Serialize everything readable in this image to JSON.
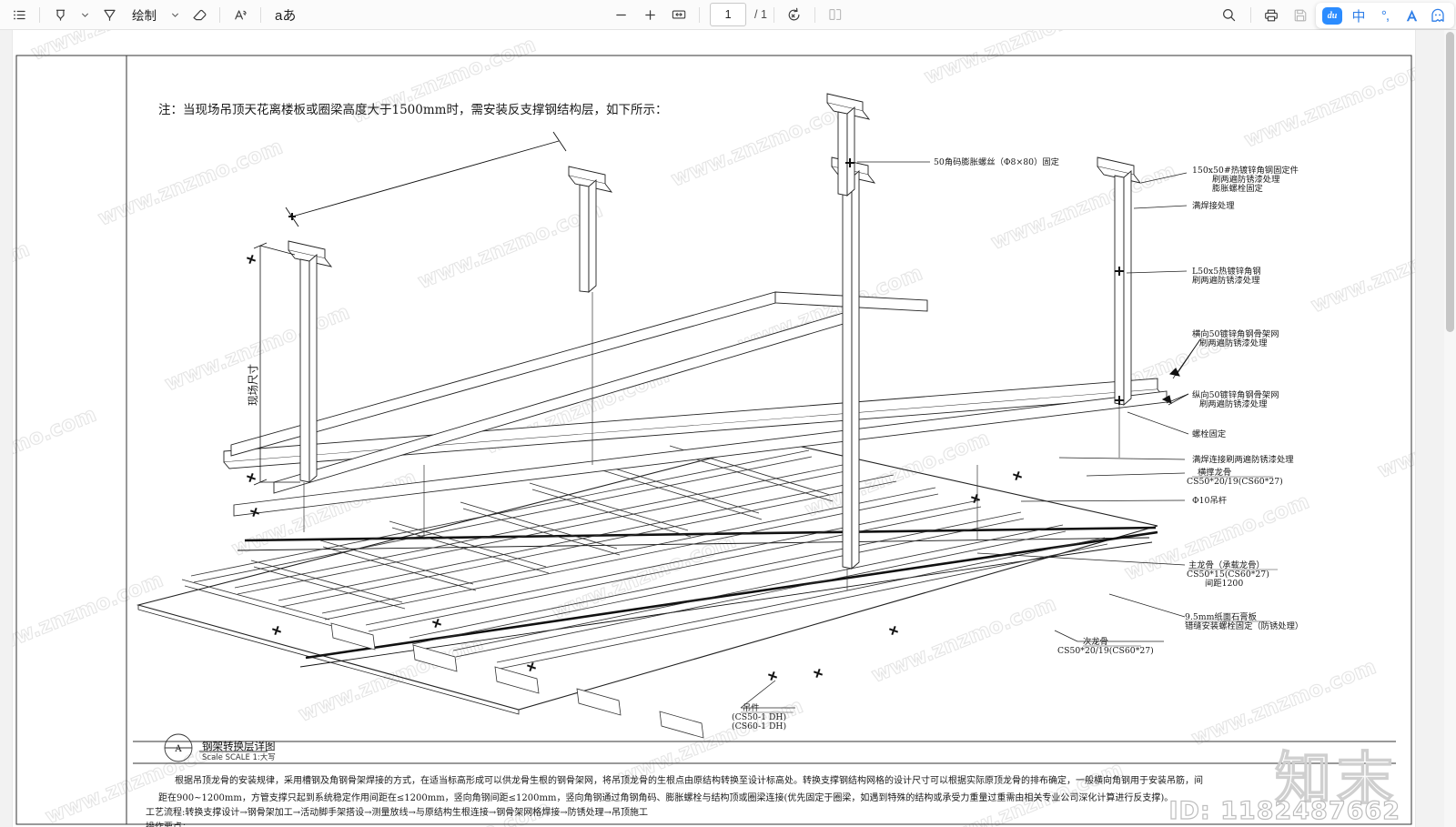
{
  "toolbar": {
    "left_tools": [
      {
        "name": "outline-list-icon",
        "label": ""
      },
      {
        "name": "highlighter-icon",
        "label": ""
      },
      {
        "name": "highlighter-dropdown-icon",
        "label": ""
      },
      {
        "name": "pen-icon",
        "label": ""
      },
      {
        "name": "draw-label",
        "label": "绘制"
      },
      {
        "name": "draw-dropdown-icon",
        "label": ""
      },
      {
        "name": "eraser-icon",
        "label": ""
      },
      {
        "name": "text-style-icon",
        "label": ""
      },
      {
        "name": "font-size-icon",
        "label": "aあ"
      }
    ],
    "draw_label": "绘制",
    "font_label": "aあ",
    "zoom_out": "−",
    "zoom_in": "+",
    "fit_width": "fit-width-icon",
    "page_current": "1",
    "page_total": "/ 1",
    "rotate": "rotate-icon",
    "dual_page": "dual-page-icon",
    "search": "search-icon",
    "print": "print-icon",
    "save": "save-icon"
  },
  "ime": {
    "logo": "du",
    "mode": "中",
    "punctuation": "°,",
    "input_icon": "A",
    "toolbox_icon": "ghost-icon"
  },
  "document": {
    "note": "注：当现场吊顶天花离楼板或圈梁高度大于1500mm时，需安装反支撑钢结构层，如下所示：",
    "vertical_dimension": "现场尺寸",
    "title_block": {
      "marker": "A",
      "title": "钢架转换层详图",
      "scale_prefix": "Scale",
      "scale_bold": "SCALE",
      "scale_value": "1:大写"
    },
    "annotations": [
      {
        "id": "a1",
        "text": "50角码膨胀螺丝（Φ8×80）固定"
      },
      {
        "id": "a2",
        "text": "150x50#热镀锌角钢固定件"
      },
      {
        "id": "a3",
        "text": "刷两遍防锈漆处理"
      },
      {
        "id": "a4",
        "text": "膨胀螺栓固定"
      },
      {
        "id": "a5",
        "text": "满焊接处理"
      },
      {
        "id": "a6",
        "text": "L50x5热镀锌角钢"
      },
      {
        "id": "a7",
        "text": "刷两遍防锈漆处理"
      },
      {
        "id": "a8",
        "text": "横向50镀锌角钢骨架网"
      },
      {
        "id": "a9",
        "text": "刷两遍防锈漆处理"
      },
      {
        "id": "a10",
        "text": "纵向50镀锌角钢骨架网"
      },
      {
        "id": "a11",
        "text": "刷两遍防锈漆处理"
      },
      {
        "id": "a12",
        "text": "螺栓固定"
      },
      {
        "id": "a13",
        "text": "满焊连接刷两遍防锈漆处理"
      },
      {
        "id": "a14",
        "text": "横撑龙骨"
      },
      {
        "id": "a15",
        "text": "CS50*20/19(CS60*27)"
      },
      {
        "id": "a16",
        "text": "Φ10吊杆"
      },
      {
        "id": "a17",
        "text": "主龙骨（承载龙骨）"
      },
      {
        "id": "a18",
        "text": "CS50*15(CS60*27)"
      },
      {
        "id": "a19",
        "text": "间距1200"
      },
      {
        "id": "a20",
        "text": "9.5mm纸面石膏板"
      },
      {
        "id": "a21",
        "text": "错缝安装螺栓固定（防锈处理）"
      },
      {
        "id": "a22",
        "text": "次龙骨"
      },
      {
        "id": "a23",
        "text": "CS50*20/19(CS60*27)"
      },
      {
        "id": "a24",
        "text": "吊件"
      },
      {
        "id": "a25",
        "text": "(CS50-1 DH)"
      },
      {
        "id": "a26",
        "text": "(CS60-1 DH)"
      }
    ],
    "notes_block": [
      "根据吊顶龙骨的安装规律，采用槽钢及角钢骨架焊接的方式，在适当标高形成可以供龙骨生根的钢骨架网，将吊顶龙骨的生根点由原结构转换至设计标高处。转换支撑钢结构网格的设计尺寸可以根据实际原顶龙骨的排布确定，一般横向角钢用于安装吊筋，间",
      "距在900~1200mm，方管支撑只起到系统稳定作用间距在≤1200mm，竖向角钢间距≤1200mm，竖向角钢通过角钢角码、膨胀螺栓与结构顶或圈梁连接(优先固定于圈梁，如遇到特殊的结构或承受力重量过重需由相关专业公司深化计算进行反支撑)。",
      "工艺流程:转换支撑设计→钢骨架加工→活动脚手架搭设→测量放线→与原结构生根连接→钢骨架网格焊接→防锈处理→吊顶施工",
      "操作要点："
    ],
    "watermark_text": "www.znzmo.com",
    "brand_watermark": "知末",
    "id_watermark": "ID: 1182487662"
  }
}
